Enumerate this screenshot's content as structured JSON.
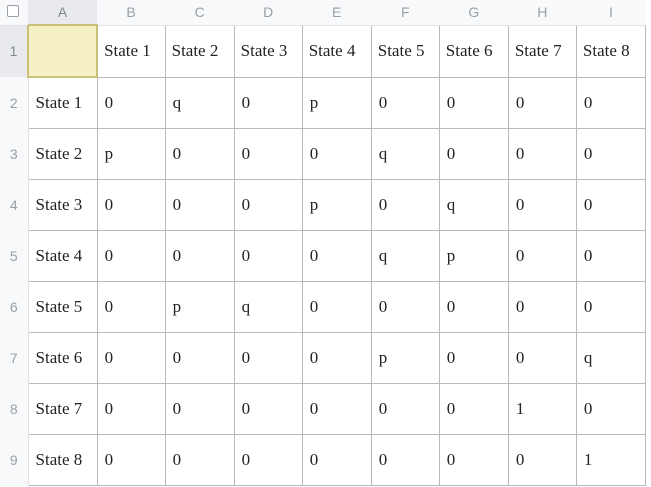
{
  "spreadsheet": {
    "column_headers": [
      "A",
      "B",
      "C",
      "D",
      "E",
      "F",
      "G",
      "H",
      "I"
    ],
    "row_numbers": [
      "1",
      "2",
      "3",
      "4",
      "5",
      "6",
      "7",
      "8",
      "9"
    ],
    "header_row": [
      "",
      "State 1",
      "State 2",
      "State 3",
      "State 4",
      "State 5",
      "State 6",
      "State 7",
      "State 8"
    ],
    "rows": [
      [
        "State 1",
        "0",
        "q",
        "0",
        "p",
        "0",
        "0",
        "0",
        "0"
      ],
      [
        "State 2",
        "p",
        "0",
        "0",
        "0",
        "q",
        "0",
        "0",
        "0"
      ],
      [
        "State 3",
        "0",
        "0",
        "0",
        "p",
        "0",
        "q",
        "0",
        "0"
      ],
      [
        "State 4",
        "0",
        "0",
        "0",
        "0",
        "q",
        "p",
        "0",
        "0"
      ],
      [
        "State 5",
        "0",
        "p",
        "q",
        "0",
        "0",
        "0",
        "0",
        "0"
      ],
      [
        "State 6",
        "0",
        "0",
        "0",
        "0",
        "p",
        "0",
        "0",
        "q"
      ],
      [
        "State 7",
        "0",
        "0",
        "0",
        "0",
        "0",
        "0",
        "1",
        "0"
      ],
      [
        "State 8",
        "0",
        "0",
        "0",
        "0",
        "0",
        "0",
        "0",
        "1"
      ]
    ],
    "selected_cell": "A1"
  }
}
